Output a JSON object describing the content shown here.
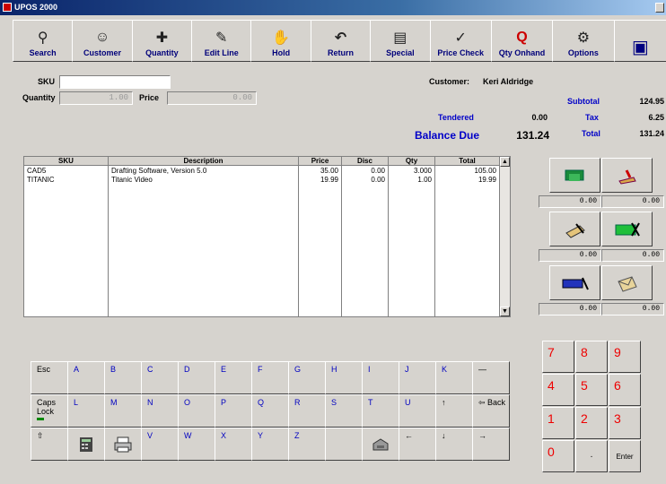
{
  "window": {
    "title": "UPOS 2000"
  },
  "toolbar": [
    {
      "label": "Search",
      "icon": "binoculars-icon",
      "glyph": "⚲"
    },
    {
      "label": "Customer",
      "icon": "customer-icon",
      "glyph": "☺"
    },
    {
      "label": "Quantity",
      "icon": "quantity-icon",
      "glyph": "✚"
    },
    {
      "label": "Edit Line",
      "icon": "edit-line-icon",
      "glyph": "✎"
    },
    {
      "label": "Hold",
      "icon": "hold-hand-icon",
      "glyph": "✋"
    },
    {
      "label": "Return",
      "icon": "return-arrow-icon",
      "glyph": "↶"
    },
    {
      "label": "Special",
      "icon": "special-icon",
      "glyph": "▤"
    },
    {
      "label": "Price Check",
      "icon": "price-check-icon",
      "glyph": "✓"
    },
    {
      "label": "Qty Onhand",
      "icon": "qty-onhand-icon",
      "glyph": "Q"
    },
    {
      "label": "Options",
      "icon": "options-icon",
      "glyph": "⚙"
    },
    {
      "label": "",
      "icon": "save-icon",
      "glyph": "▣"
    }
  ],
  "form": {
    "sku_label": "SKU",
    "sku_value": "",
    "quantity_label": "Quantity",
    "quantity_value": "1.00",
    "price_label": "Price",
    "price_value": "0.00"
  },
  "customer": {
    "label": "Customer:",
    "name": "Keri Aldridge"
  },
  "totals": {
    "subtotal_label": "Subtotal",
    "subtotal": "124.95",
    "tax_label": "Tax",
    "tax": "6.25",
    "total_label": "Total",
    "total": "131.24",
    "tendered_label": "Tendered",
    "tendered": "0.00",
    "balance_label": "Balance Due",
    "balance": "131.24"
  },
  "grid": {
    "headers": [
      "SKU",
      "Description",
      "Price",
      "Disc",
      "Qty",
      "Total"
    ],
    "rows": [
      {
        "sku": "CAD5",
        "description": "Drafting Software, Version 5.0",
        "price": "35.00",
        "disc": "0.00",
        "qty": "3.000",
        "total": "105.00"
      },
      {
        "sku": "TITANIC",
        "description": "Titanic Video",
        "price": "19.99",
        "disc": "0.00",
        "qty": "1.00",
        "total": "19.99"
      }
    ]
  },
  "tender_amounts": [
    "0.00",
    "0.00",
    "0.00",
    "0.00",
    "0.00",
    "0.00"
  ],
  "keypad": [
    "7",
    "8",
    "9",
    "4",
    "5",
    "6",
    "1",
    "2",
    "3",
    "0",
    ".",
    "Enter"
  ],
  "keyboard": {
    "row1": [
      "Esc",
      "A",
      "B",
      "C",
      "D",
      "E",
      "F",
      "G",
      "H",
      "I",
      "J",
      "K",
      "—"
    ],
    "row2": [
      "Caps Lock",
      "L",
      "M",
      "N",
      "O",
      "P",
      "Q",
      "R",
      "S",
      "T",
      "U",
      "↑",
      "⇦ Back"
    ],
    "row3": [
      "⇧",
      "",
      "",
      "V",
      "W",
      "X",
      "Y",
      "Z",
      "",
      "",
      "←",
      "↓",
      "→"
    ]
  }
}
